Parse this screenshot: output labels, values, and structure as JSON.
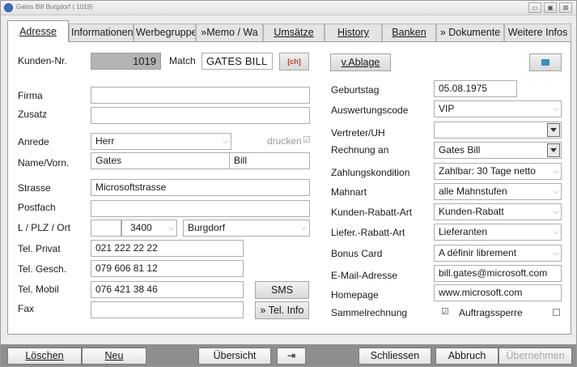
{
  "window": {
    "title": "Gates Bill Burgdorf ( 1019)"
  },
  "window_buttons": {
    "minimize": "▭",
    "maximize": "▣",
    "close": "⊠"
  },
  "tabs": [
    {
      "label": "Adresse",
      "active": true
    },
    {
      "label": "Informationen"
    },
    {
      "label": "Werbegruppe"
    },
    {
      "label": "»Memo / Wa"
    },
    {
      "label": "Umsätze"
    },
    {
      "label": "History"
    },
    {
      "label": "Banken"
    },
    {
      "label": "» Dokumente"
    },
    {
      "label": "Weitere Infos"
    }
  ],
  "left": {
    "kunden_nr_label": "Kunden-Nr.",
    "kunden_nr": "1019",
    "match_label": "Match",
    "match_value": "GATES BILL",
    "ch_label": "[ch]",
    "firma_label": "Firma",
    "firma_value": "",
    "zusatz_label": "Zusatz",
    "zusatz_value": "",
    "anrede_label": "Anrede",
    "anrede_value": "Herr",
    "drucken_label": "drucken",
    "drucken_check": "☑",
    "name_label": "Name/Vorn.",
    "name_value": "Gates",
    "vorname_value": "Bill",
    "strasse_label": "Strasse",
    "strasse_value": "Microsoftstrasse",
    "postfach_label": "Postfach",
    "postfach_value": "",
    "lplzort_label": "L / PLZ / Ort",
    "land_value": "",
    "plz_value": "3400",
    "ort_value": "Burgdorf",
    "tel_privat_label": "Tel. Privat",
    "tel_privat_value": "021 222 22 22",
    "tel_gesch_label": "Tel. Gesch.",
    "tel_gesch_value": "079 606 81 12",
    "tel_mobil_label": "Tel. Mobil",
    "tel_mobil_value": "076 421 38 46",
    "fax_label": "Fax",
    "fax_value": "",
    "sms_button": "SMS",
    "tel_info_button": "» Tel. Info"
  },
  "right": {
    "v_ablage_button": "v.Ablage",
    "geburtstag_label": "Geburtstag",
    "geburtstag_value": "05.08.1975",
    "auswertungscode_label": "Auswertungscode",
    "auswertungscode_value": "VIP",
    "vertreter_label": "Vertreter/UH",
    "vertreter_value": "",
    "rechnung_an_label": "Rechnung an",
    "rechnung_an_value": "Gates Bill",
    "zahlungskondition_label": "Zahlungskondition",
    "zahlungskondition_value": "Zahlbar: 30 Tage netto",
    "mahnart_label": "Mahnart",
    "mahnart_value": "alle Mahnstufen",
    "kunden_rabatt_label": "Kunden-Rabatt-Art",
    "kunden_rabatt_value": "Kunden-Rabatt",
    "liefer_rabatt_label": "Liefer.-Rabatt-Art",
    "liefer_rabatt_value": "Lieferanten",
    "bonus_card_label": "Bonus Card",
    "bonus_card_value": "A définir librement",
    "email_label": "E-Mail-Adresse",
    "email_value": "bill.gates@microsoft.com",
    "homepage_label": "Homepage",
    "homepage_value": "www.microsoft.com",
    "sammelrechnung_label": "Sammelrechnung",
    "sammelrechnung_check": "☑",
    "auftragssperre_label": "Auftragssperre",
    "auftragssperre_check": ""
  },
  "bottom": {
    "loeschen": "Löschen",
    "neu": "Neu",
    "uebersicht": "Übersicht",
    "pin": "⇥",
    "schliessen": "Schliessen",
    "abbruch": "Abbruch",
    "uebernehmen": "Übernehmen"
  }
}
